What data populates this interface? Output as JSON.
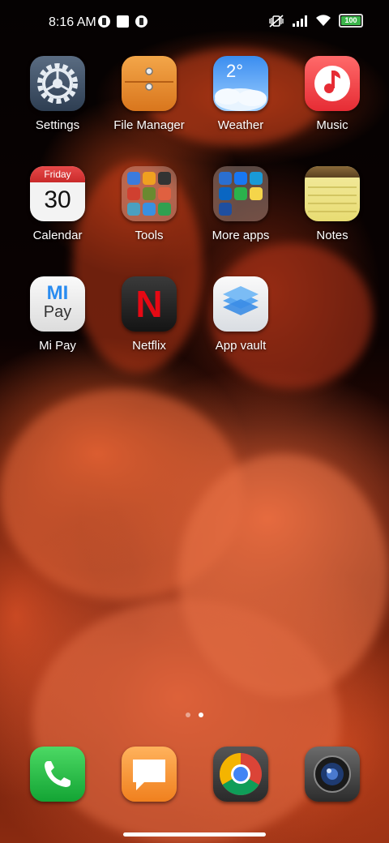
{
  "status_bar": {
    "time": "8:16 AM",
    "battery": "100",
    "left_icons": [
      "notification-icon",
      "square-notification-icon",
      "notification-icon"
    ],
    "right_icons": [
      "vibrate-off-icon",
      "signal-icon",
      "wifi-icon",
      "battery-icon"
    ]
  },
  "apps": [
    {
      "label": "Settings",
      "icon": "gear-icon"
    },
    {
      "label": "File Manager",
      "icon": "folder-envelope-icon"
    },
    {
      "label": "Weather",
      "icon": "cloud-icon",
      "temperature": "2°"
    },
    {
      "label": "Music",
      "icon": "music-note-icon"
    },
    {
      "label": "Calendar",
      "icon": "calendar-icon",
      "day_name": "Friday",
      "day_number": "30"
    },
    {
      "label": "Tools",
      "icon": "folder-icon"
    },
    {
      "label": "More apps",
      "icon": "folder-icon"
    },
    {
      "label": "Notes",
      "icon": "notepad-icon"
    },
    {
      "label": "Mi Pay",
      "icon": "mi-pay-logo-icon",
      "logo_top": "MI",
      "logo_bottom": "Pay"
    },
    {
      "label": "Netflix",
      "icon": "netflix-logo-icon",
      "logo": "N"
    },
    {
      "label": "App vault",
      "icon": "stacked-layers-icon"
    }
  ],
  "dock": [
    {
      "name": "phone",
      "icon": "phone-icon"
    },
    {
      "name": "messages",
      "icon": "message-bubble-icon"
    },
    {
      "name": "chrome",
      "icon": "chrome-icon"
    },
    {
      "name": "camera",
      "icon": "camera-icon"
    }
  ],
  "pages": {
    "count": 2,
    "active": 2
  },
  "colors": {
    "accent_red": "#e62c34",
    "battery_green": "#3bb54a"
  }
}
